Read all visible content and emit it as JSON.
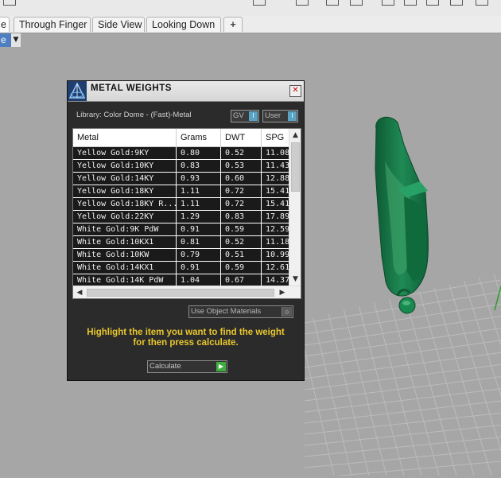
{
  "tabs": {
    "partial": "e",
    "through_finger": "Through Finger",
    "side_view": "Side View",
    "looking_down": "Looking Down",
    "add": "+"
  },
  "viewport": {
    "label_partial": "e",
    "menu_arrow": "▼"
  },
  "dialog": {
    "title": "METAL WEIGHTS",
    "close": "✕",
    "library_label": "Library: Color Dome - (Fast)-Metal",
    "gv_label": "GV",
    "user_label": "User",
    "toggle_glyph": "I",
    "use_object_materials": "Use Object Materials",
    "instruction_line1": "Highlight the item you want to find the weight",
    "instruction_line2": "for then press calculate.",
    "calculate_label": "Calculate"
  },
  "table": {
    "headers": [
      "Metal",
      "Grams",
      "DWT",
      "SPG"
    ],
    "rows": [
      [
        "Yellow Gold:9KY",
        "0.80",
        "0.52",
        "11.08"
      ],
      [
        "Yellow Gold:10KY",
        "0.83",
        "0.53",
        "11.43"
      ],
      [
        "Yellow Gold:14KY",
        "0.93",
        "0.60",
        "12.88"
      ],
      [
        "Yellow Gold:18KY",
        "1.11",
        "0.72",
        "15.41"
      ],
      [
        "Yellow Gold:18KY R...",
        "1.11",
        "0.72",
        "15.41"
      ],
      [
        "Yellow Gold:22KY",
        "1.29",
        "0.83",
        "17.89"
      ],
      [
        "White Gold:9K PdW",
        "0.91",
        "0.59",
        "12.59"
      ],
      [
        "White Gold:10KX1",
        "0.81",
        "0.52",
        "11.18"
      ],
      [
        "White Gold:10KW",
        "0.79",
        "0.51",
        "10.99"
      ],
      [
        "White Gold:14KX1",
        "0.91",
        "0.59",
        "12.61"
      ],
      [
        "White Gold:14K PdW",
        "1.04",
        "0.67",
        "14.37"
      ]
    ]
  },
  "colors": {
    "viewport_bg": "#a6a6a6",
    "dialog_bg": "#2b2b2b",
    "instruction": "#e9c72d",
    "model_green": "#1e7a4a"
  }
}
